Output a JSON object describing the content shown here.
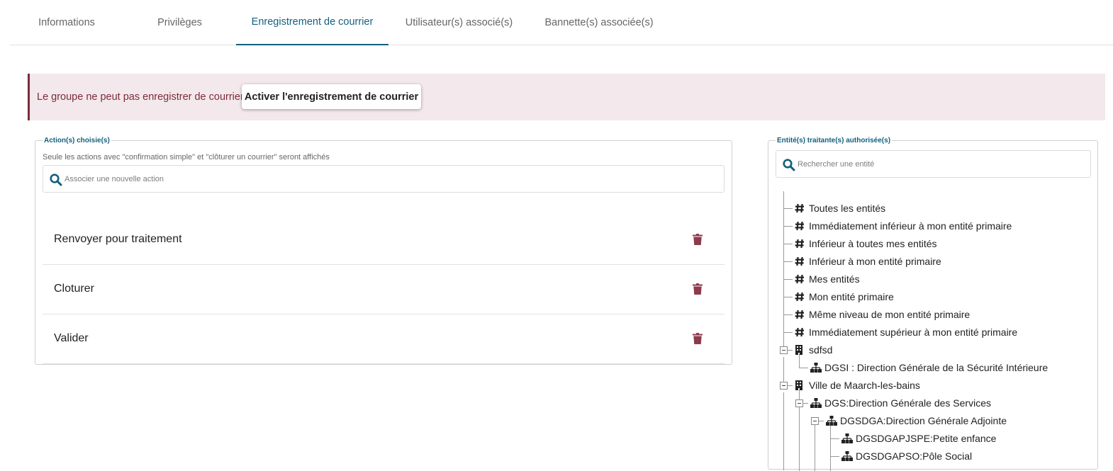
{
  "tabs": [
    {
      "label": "Informations"
    },
    {
      "label": "Privilèges"
    },
    {
      "label": "Enregistrement de courrier"
    },
    {
      "label": "Utilisateur(s) associé(s)"
    },
    {
      "label": "Bannette(s) associée(s)"
    }
  ],
  "active_tab": "Enregistrement de courrier",
  "alert": {
    "message": "Le groupe ne peut pas enregistrer de courrier.",
    "button_label": "Activer l'enregistrement de courrier"
  },
  "actions_panel": {
    "legend": "Action(s) choisie(s)",
    "note": "Seule les actions avec \"confirmation simple\" et \"clôturer un courrier\" seront affichés",
    "search_placeholder": "Associer une nouvelle action",
    "items": [
      {
        "label": "Renvoyer pour traitement"
      },
      {
        "label": "Cloturer"
      },
      {
        "label": "Valider"
      }
    ]
  },
  "entities_panel": {
    "legend": "Entité(s) traitante(s) authorisée(s)",
    "search_placeholder": "Rechercher une entité",
    "tree": [
      {
        "label": "Toutes les entités",
        "icon": "hash-icon"
      },
      {
        "label": "Immédiatement inférieur à mon entité primaire",
        "icon": "hash-icon"
      },
      {
        "label": "Inférieur à toutes mes entités",
        "icon": "hash-icon"
      },
      {
        "label": "Inférieur à mon entité primaire",
        "icon": "hash-icon"
      },
      {
        "label": "Mes entités",
        "icon": "hash-icon"
      },
      {
        "label": "Mon entité primaire",
        "icon": "hash-icon"
      },
      {
        "label": "Même niveau de mon entité primaire",
        "icon": "hash-icon"
      },
      {
        "label": "Immédiatement supérieur à mon entité primaire",
        "icon": "hash-icon"
      },
      {
        "label": "sdfsd",
        "icon": "building-icon"
      },
      {
        "label": "DGSI : Direction Générale de la Sécurité Intérieure",
        "icon": "sitemap-icon"
      },
      {
        "label": "Ville de Maarch-les-bains",
        "icon": "building-icon"
      },
      {
        "label": "DGS:Direction Générale des Services",
        "icon": "sitemap-icon"
      },
      {
        "label": "DGSDGA:Direction Générale Adjointe",
        "icon": "sitemap-icon"
      },
      {
        "label": "DGSDGAPJSPE:Petite enfance",
        "icon": "sitemap-icon"
      },
      {
        "label": "DGSDGAPSO:Pôle Social",
        "icon": "sitemap-icon"
      }
    ]
  },
  "colors": {
    "accent": "#135f7f",
    "alert_bg": "#f3e8eb",
    "alert_text": "#7d2b3b",
    "trash": "#8d3a4c"
  }
}
